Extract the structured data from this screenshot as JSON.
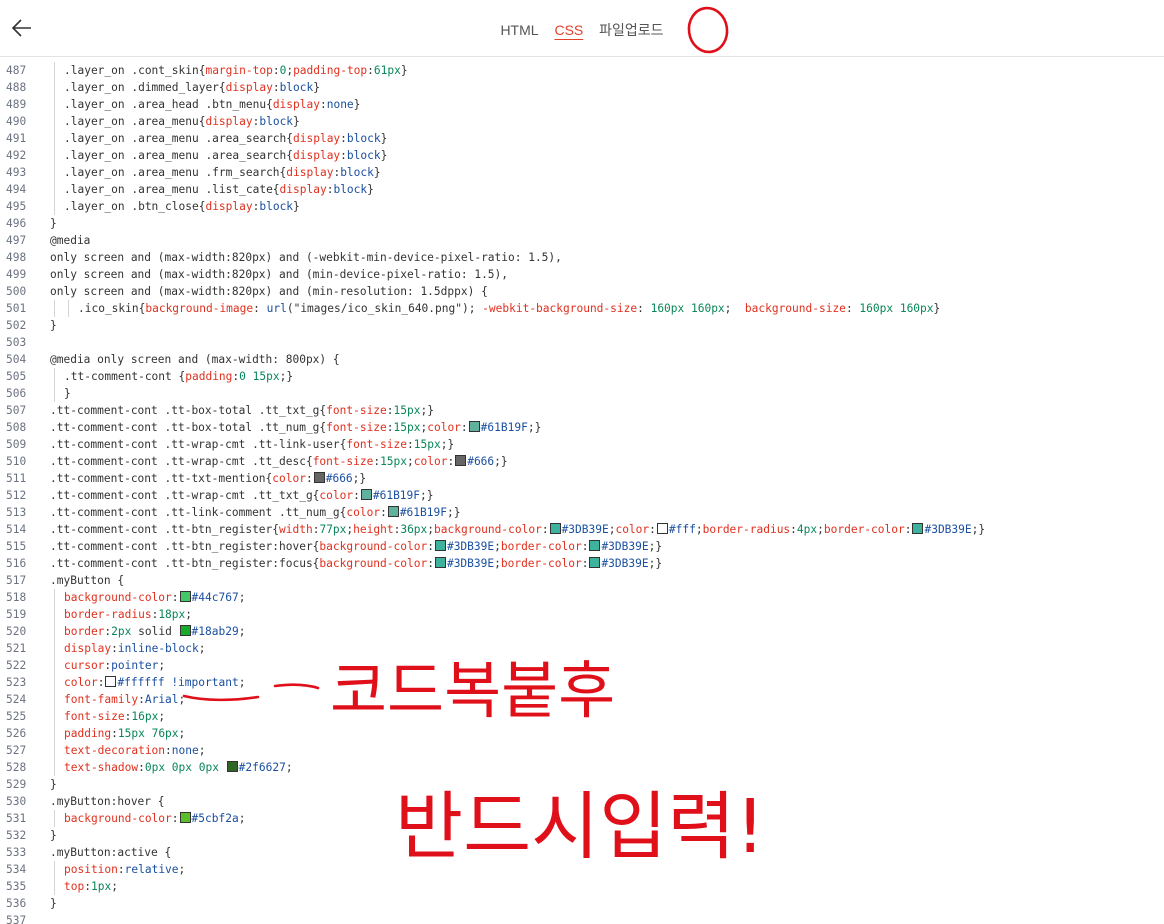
{
  "header": {
    "tabs": [
      {
        "label": "HTML",
        "active": false
      },
      {
        "label": "CSS",
        "active": true
      },
      {
        "label": "파일업로드",
        "active": false
      }
    ]
  },
  "colors": {
    "accent": "#e4402a",
    "annotation": "#e0101a",
    "property": "#e0301e",
    "value": "#1a4fa0",
    "number": "#098658"
  },
  "code_lines": [
    {
      "n": "487",
      "i": 1,
      "t": [
        [
          "s",
          ".layer_on .cont_skin{"
        ],
        [
          "p",
          "margin-top"
        ],
        [
          "s",
          ":"
        ],
        [
          "n",
          "0"
        ],
        [
          "s",
          ";"
        ],
        [
          "p",
          "padding-top"
        ],
        [
          "s",
          ":"
        ],
        [
          "n",
          "61px"
        ],
        [
          "s",
          "}"
        ]
      ]
    },
    {
      "n": "488",
      "i": 1,
      "t": [
        [
          "s",
          ".layer_on .dimmed_layer{"
        ],
        [
          "p",
          "display"
        ],
        [
          "s",
          ":"
        ],
        [
          "v",
          "block"
        ],
        [
          "s",
          "}"
        ]
      ]
    },
    {
      "n": "489",
      "i": 1,
      "t": [
        [
          "s",
          ".layer_on .area_head .btn_menu{"
        ],
        [
          "p",
          "display"
        ],
        [
          "s",
          ":"
        ],
        [
          "v",
          "none"
        ],
        [
          "s",
          "}"
        ]
      ]
    },
    {
      "n": "490",
      "i": 1,
      "t": [
        [
          "s",
          ".layer_on .area_menu{"
        ],
        [
          "p",
          "display"
        ],
        [
          "s",
          ":"
        ],
        [
          "v",
          "block"
        ],
        [
          "s",
          "}"
        ]
      ]
    },
    {
      "n": "491",
      "i": 1,
      "t": [
        [
          "s",
          ".layer_on .area_menu .area_search{"
        ],
        [
          "p",
          "display"
        ],
        [
          "s",
          ":"
        ],
        [
          "v",
          "block"
        ],
        [
          "s",
          "}"
        ]
      ]
    },
    {
      "n": "492",
      "i": 1,
      "t": [
        [
          "s",
          ".layer_on .area_menu .area_search{"
        ],
        [
          "p",
          "display"
        ],
        [
          "s",
          ":"
        ],
        [
          "v",
          "block"
        ],
        [
          "s",
          "}"
        ]
      ]
    },
    {
      "n": "493",
      "i": 1,
      "t": [
        [
          "s",
          ".layer_on .area_menu .frm_search{"
        ],
        [
          "p",
          "display"
        ],
        [
          "s",
          ":"
        ],
        [
          "v",
          "block"
        ],
        [
          "s",
          "}"
        ]
      ]
    },
    {
      "n": "494",
      "i": 1,
      "t": [
        [
          "s",
          ".layer_on .area_menu .list_cate{"
        ],
        [
          "p",
          "display"
        ],
        [
          "s",
          ":"
        ],
        [
          "v",
          "block"
        ],
        [
          "s",
          "}"
        ]
      ]
    },
    {
      "n": "495",
      "i": 1,
      "t": [
        [
          "s",
          ".layer_on .btn_close{"
        ],
        [
          "p",
          "display"
        ],
        [
          "s",
          ":"
        ],
        [
          "v",
          "block"
        ],
        [
          "s",
          "}"
        ]
      ]
    },
    {
      "n": "496",
      "i": 0,
      "t": [
        [
          "s",
          "}"
        ]
      ]
    },
    {
      "n": "497",
      "i": 0,
      "t": [
        [
          "s",
          "@media"
        ]
      ]
    },
    {
      "n": "498",
      "i": 0,
      "t": [
        [
          "s",
          "only screen and (max-width:820px) and (-webkit-min-device-pixel-ratio: 1.5),"
        ]
      ]
    },
    {
      "n": "499",
      "i": 0,
      "t": [
        [
          "s",
          "only screen and (max-width:820px) and (min-device-pixel-ratio: 1.5),"
        ]
      ]
    },
    {
      "n": "500",
      "i": 0,
      "t": [
        [
          "s",
          "only screen and (max-width:820px) and (min-resolution: 1.5dppx) {"
        ]
      ]
    },
    {
      "n": "501",
      "i": 2,
      "t": [
        [
          "s",
          ".ico_skin{"
        ],
        [
          "p",
          "background-image"
        ],
        [
          "s",
          ": "
        ],
        [
          "v",
          "url"
        ],
        [
          "s",
          "(\"images/ico_skin_640.png\"); "
        ],
        [
          "p",
          "-webkit-background-size"
        ],
        [
          "s",
          ": "
        ],
        [
          "n",
          "160px 160px"
        ],
        [
          "s",
          ";  "
        ],
        [
          "p",
          "background-size"
        ],
        [
          "s",
          ": "
        ],
        [
          "n",
          "160px 160px"
        ],
        [
          "s",
          "}"
        ]
      ]
    },
    {
      "n": "502",
      "i": 0,
      "t": [
        [
          "s",
          "}"
        ]
      ]
    },
    {
      "n": "503",
      "i": 0,
      "t": []
    },
    {
      "n": "504",
      "i": 0,
      "t": [
        [
          "s",
          "@media only screen and (max-width: 800px) {"
        ]
      ]
    },
    {
      "n": "505",
      "i": 1,
      "t": [
        [
          "s",
          ".tt-comment-cont {"
        ],
        [
          "p",
          "padding"
        ],
        [
          "s",
          ":"
        ],
        [
          "n",
          "0 15px"
        ],
        [
          "s",
          ";}"
        ]
      ]
    },
    {
      "n": "506",
      "i": 1,
      "t": [
        [
          "s",
          "}"
        ]
      ]
    },
    {
      "n": "507",
      "i": 0,
      "t": [
        [
          "s",
          ".tt-comment-cont .tt-box-total .tt_txt_g{"
        ],
        [
          "p",
          "font-size"
        ],
        [
          "s",
          ":"
        ],
        [
          "n",
          "15px"
        ],
        [
          "s",
          ";}"
        ]
      ]
    },
    {
      "n": "508",
      "i": 0,
      "t": [
        [
          "s",
          ".tt-comment-cont .tt-box-total .tt_num_g{"
        ],
        [
          "p",
          "font-size"
        ],
        [
          "s",
          ":"
        ],
        [
          "n",
          "15px"
        ],
        [
          "s",
          ";"
        ],
        [
          "p",
          "color"
        ],
        [
          "s",
          ":"
        ],
        [
          "c",
          "#61B19F"
        ],
        [
          "v",
          "#61B19F"
        ],
        [
          "s",
          ";}"
        ]
      ]
    },
    {
      "n": "509",
      "i": 0,
      "t": [
        [
          "s",
          ".tt-comment-cont .tt-wrap-cmt .tt-link-user{"
        ],
        [
          "p",
          "font-size"
        ],
        [
          "s",
          ":"
        ],
        [
          "n",
          "15px"
        ],
        [
          "s",
          ";}"
        ]
      ]
    },
    {
      "n": "510",
      "i": 0,
      "t": [
        [
          "s",
          ".tt-comment-cont .tt-wrap-cmt .tt_desc{"
        ],
        [
          "p",
          "font-size"
        ],
        [
          "s",
          ":"
        ],
        [
          "n",
          "15px"
        ],
        [
          "s",
          ";"
        ],
        [
          "p",
          "color"
        ],
        [
          "s",
          ":"
        ],
        [
          "c",
          "#666"
        ],
        [
          "v",
          "#666"
        ],
        [
          "s",
          ";}"
        ]
      ]
    },
    {
      "n": "511",
      "i": 0,
      "t": [
        [
          "s",
          ".tt-comment-cont .tt-txt-mention{"
        ],
        [
          "p",
          "color"
        ],
        [
          "s",
          ":"
        ],
        [
          "c",
          "#666"
        ],
        [
          "v",
          "#666"
        ],
        [
          "s",
          ";}"
        ]
      ]
    },
    {
      "n": "512",
      "i": 0,
      "t": [
        [
          "s",
          ".tt-comment-cont .tt-wrap-cmt .tt_txt_g{"
        ],
        [
          "p",
          "color"
        ],
        [
          "s",
          ":"
        ],
        [
          "c",
          "#61B19F"
        ],
        [
          "v",
          "#61B19F"
        ],
        [
          "s",
          ";}"
        ]
      ]
    },
    {
      "n": "513",
      "i": 0,
      "t": [
        [
          "s",
          ".tt-comment-cont .tt-link-comment .tt_num_g{"
        ],
        [
          "p",
          "color"
        ],
        [
          "s",
          ":"
        ],
        [
          "c",
          "#61B19F"
        ],
        [
          "v",
          "#61B19F"
        ],
        [
          "s",
          ";}"
        ]
      ]
    },
    {
      "n": "514",
      "i": 0,
      "t": [
        [
          "s",
          ".tt-comment-cont .tt-btn_register{"
        ],
        [
          "p",
          "width"
        ],
        [
          "s",
          ":"
        ],
        [
          "n",
          "77px"
        ],
        [
          "s",
          ";"
        ],
        [
          "p",
          "height"
        ],
        [
          "s",
          ":"
        ],
        [
          "n",
          "36px"
        ],
        [
          "s",
          ";"
        ],
        [
          "p",
          "background-color"
        ],
        [
          "s",
          ":"
        ],
        [
          "c",
          "#3DB39E"
        ],
        [
          "v",
          "#3DB39E"
        ],
        [
          "s",
          ";"
        ],
        [
          "p",
          "color"
        ],
        [
          "s",
          ":"
        ],
        [
          "c",
          "#fff"
        ],
        [
          "v",
          "#fff"
        ],
        [
          "s",
          ";"
        ],
        [
          "p",
          "border-radius"
        ],
        [
          "s",
          ":"
        ],
        [
          "n",
          "4px"
        ],
        [
          "s",
          ";"
        ],
        [
          "p",
          "border-color"
        ],
        [
          "s",
          ":"
        ],
        [
          "c",
          "#3DB39E"
        ],
        [
          "v",
          "#3DB39E"
        ],
        [
          "s",
          ";}"
        ]
      ]
    },
    {
      "n": "515",
      "i": 0,
      "t": [
        [
          "s",
          ".tt-comment-cont .tt-btn_register:hover{"
        ],
        [
          "p",
          "background-color"
        ],
        [
          "s",
          ":"
        ],
        [
          "c",
          "#3DB39E"
        ],
        [
          "v",
          "#3DB39E"
        ],
        [
          "s",
          ";"
        ],
        [
          "p",
          "border-color"
        ],
        [
          "s",
          ":"
        ],
        [
          "c",
          "#3DB39E"
        ],
        [
          "v",
          "#3DB39E"
        ],
        [
          "s",
          ";}"
        ]
      ]
    },
    {
      "n": "516",
      "i": 0,
      "t": [
        [
          "s",
          ".tt-comment-cont .tt-btn_register:focus{"
        ],
        [
          "p",
          "background-color"
        ],
        [
          "s",
          ":"
        ],
        [
          "c",
          "#3DB39E"
        ],
        [
          "v",
          "#3DB39E"
        ],
        [
          "s",
          ";"
        ],
        [
          "p",
          "border-color"
        ],
        [
          "s",
          ":"
        ],
        [
          "c",
          "#3DB39E"
        ],
        [
          "v",
          "#3DB39E"
        ],
        [
          "s",
          ";}"
        ]
      ]
    },
    {
      "n": "517",
      "i": 0,
      "t": [
        [
          "s",
          ".myButton {"
        ]
      ]
    },
    {
      "n": "518",
      "i": 1,
      "t": [
        [
          "p",
          "background-color"
        ],
        [
          "s",
          ":"
        ],
        [
          "c",
          "#44c767"
        ],
        [
          "v",
          "#44c767"
        ],
        [
          "s",
          ";"
        ]
      ]
    },
    {
      "n": "519",
      "i": 1,
      "t": [
        [
          "p",
          "border-radius"
        ],
        [
          "s",
          ":"
        ],
        [
          "n",
          "18px"
        ],
        [
          "s",
          ";"
        ]
      ]
    },
    {
      "n": "520",
      "i": 1,
      "t": [
        [
          "p",
          "border"
        ],
        [
          "s",
          ":"
        ],
        [
          "n",
          "2px"
        ],
        [
          "s",
          " solid "
        ],
        [
          "c",
          "#18ab29"
        ],
        [
          "v",
          "#18ab29"
        ],
        [
          "s",
          ";"
        ]
      ]
    },
    {
      "n": "521",
      "i": 1,
      "t": [
        [
          "p",
          "display"
        ],
        [
          "s",
          ":"
        ],
        [
          "v",
          "inline-block"
        ],
        [
          "s",
          ";"
        ]
      ]
    },
    {
      "n": "522",
      "i": 1,
      "t": [
        [
          "p",
          "cursor"
        ],
        [
          "s",
          ":"
        ],
        [
          "v",
          "pointer"
        ],
        [
          "s",
          ";"
        ]
      ]
    },
    {
      "n": "523",
      "i": 1,
      "t": [
        [
          "p",
          "color"
        ],
        [
          "s",
          ":"
        ],
        [
          "c",
          "#ffffff"
        ],
        [
          "v",
          "#ffffff !important"
        ],
        [
          "s",
          ";"
        ]
      ]
    },
    {
      "n": "524",
      "i": 1,
      "t": [
        [
          "p",
          "font-family"
        ],
        [
          "s",
          ":"
        ],
        [
          "v",
          "Arial"
        ],
        [
          "s",
          ";"
        ]
      ]
    },
    {
      "n": "525",
      "i": 1,
      "t": [
        [
          "p",
          "font-size"
        ],
        [
          "s",
          ":"
        ],
        [
          "n",
          "16px"
        ],
        [
          "s",
          ";"
        ]
      ]
    },
    {
      "n": "526",
      "i": 1,
      "t": [
        [
          "p",
          "padding"
        ],
        [
          "s",
          ":"
        ],
        [
          "n",
          "15px 76px"
        ],
        [
          "s",
          ";"
        ]
      ]
    },
    {
      "n": "527",
      "i": 1,
      "t": [
        [
          "p",
          "text-decoration"
        ],
        [
          "s",
          ":"
        ],
        [
          "v",
          "none"
        ],
        [
          "s",
          ";"
        ]
      ]
    },
    {
      "n": "528",
      "i": 1,
      "t": [
        [
          "p",
          "text-shadow"
        ],
        [
          "s",
          ":"
        ],
        [
          "n",
          "0px 0px 0px "
        ],
        [
          "c",
          "#2f6627"
        ],
        [
          "v",
          "#2f6627"
        ],
        [
          "s",
          ";"
        ]
      ]
    },
    {
      "n": "529",
      "i": 0,
      "t": [
        [
          "s",
          "}"
        ]
      ]
    },
    {
      "n": "530",
      "i": 0,
      "t": [
        [
          "s",
          ".myButton:hover {"
        ]
      ]
    },
    {
      "n": "531",
      "i": 1,
      "t": [
        [
          "p",
          "background-color"
        ],
        [
          "s",
          ":"
        ],
        [
          "c",
          "#5cbf2a"
        ],
        [
          "v",
          "#5cbf2a"
        ],
        [
          "s",
          ";"
        ]
      ]
    },
    {
      "n": "532",
      "i": 0,
      "t": [
        [
          "s",
          "}"
        ]
      ]
    },
    {
      "n": "533",
      "i": 0,
      "t": [
        [
          "s",
          ".myButton:active {"
        ]
      ]
    },
    {
      "n": "534",
      "i": 1,
      "t": [
        [
          "p",
          "position"
        ],
        [
          "s",
          ":"
        ],
        [
          "v",
          "relative"
        ],
        [
          "s",
          ";"
        ]
      ]
    },
    {
      "n": "535",
      "i": 1,
      "t": [
        [
          "p",
          "top"
        ],
        [
          "s",
          ":"
        ],
        [
          "n",
          "1px"
        ],
        [
          "s",
          ";"
        ]
      ]
    },
    {
      "n": "536",
      "i": 0,
      "t": [
        [
          "s",
          "}"
        ]
      ]
    },
    {
      "n": "537",
      "i": 0,
      "t": []
    }
  ],
  "annotation": {
    "line1": "코드복붙후",
    "line2": "반드시입력!"
  }
}
